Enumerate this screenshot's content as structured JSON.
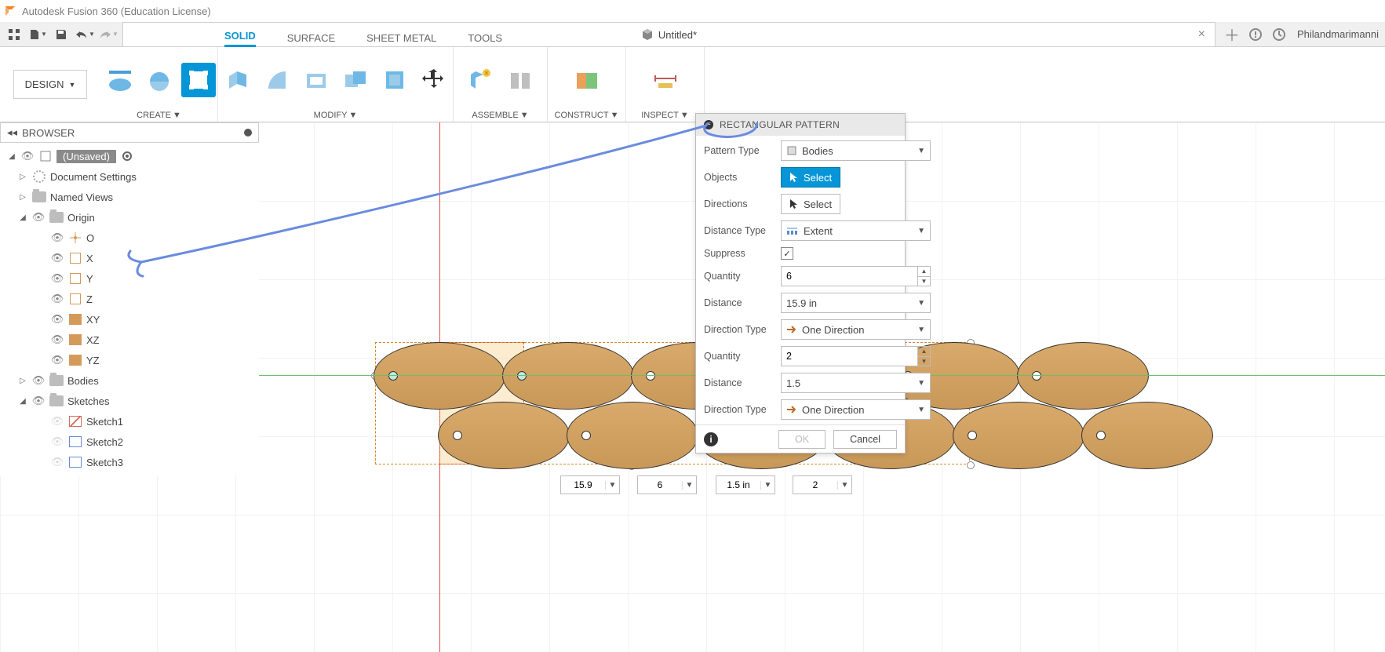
{
  "app_title": "Autodesk Fusion 360 (Education License)",
  "doc_tab": "Untitled*",
  "user_name": "Philandmarimanni",
  "workspace": "DESIGN",
  "ribbon_tabs": [
    "SOLID",
    "SURFACE",
    "SHEET METAL",
    "TOOLS"
  ],
  "ribbon_groups": {
    "create": "CREATE",
    "modify": "MODIFY",
    "assemble": "ASSEMBLE",
    "construct": "CONSTRUCT",
    "inspect": "INSPECT"
  },
  "browser": {
    "title": "BROWSER",
    "root": "(Unsaved)",
    "doc_settings": "Document Settings",
    "named_views": "Named Views",
    "origin": "Origin",
    "origin_items": [
      "O",
      "X",
      "Y",
      "Z",
      "XY",
      "XZ",
      "YZ"
    ],
    "bodies": "Bodies",
    "sketches": "Sketches",
    "sketch_items": [
      "Sketch1",
      "Sketch2",
      "Sketch3"
    ]
  },
  "dialog": {
    "title": "RECTANGULAR PATTERN",
    "pattern_type_label": "Pattern Type",
    "pattern_type_value": "Bodies",
    "objects_label": "Objects",
    "directions_label": "Directions",
    "select": "Select",
    "distance_type_label": "Distance Type",
    "distance_type_value": "Extent",
    "suppress_label": "Suppress",
    "suppress_checked": true,
    "qty1_label": "Quantity",
    "qty1_value": "6",
    "dist1_label": "Distance",
    "dist1_value": "15.9 in",
    "dir1_label": "Direction Type",
    "dir1_value": "One Direction",
    "qty2_label": "Quantity",
    "qty2_value": "2",
    "dist2_label": "Distance",
    "dist2_value": "1.5",
    "dir2_label": "Direction Type",
    "dir2_value": "One Direction",
    "ok": "OK",
    "cancel": "Cancel"
  },
  "floats": {
    "d1": "15.9",
    "q1": "6",
    "d2": "1.5 in",
    "q2": "2"
  }
}
